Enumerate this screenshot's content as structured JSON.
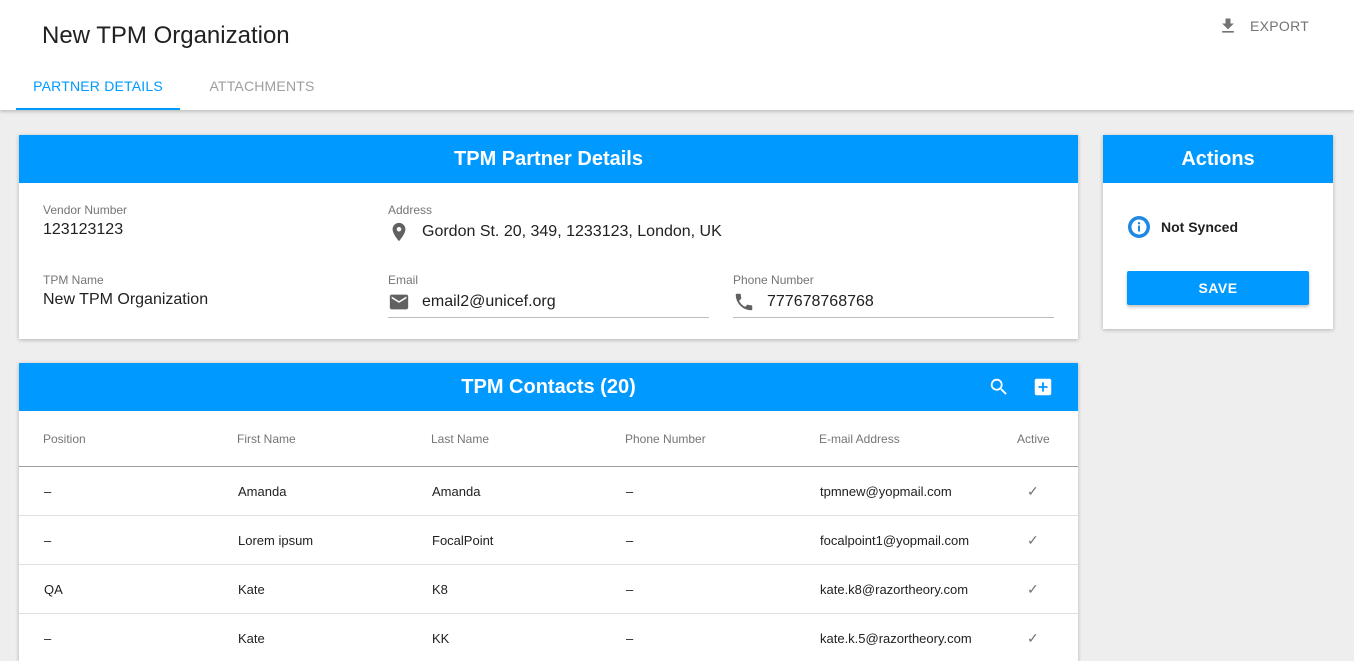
{
  "header": {
    "title": "New TPM Organization",
    "export_label": "EXPORT",
    "tabs": [
      {
        "label": "PARTNER DETAILS",
        "active": true
      },
      {
        "label": "ATTACHMENTS",
        "active": false
      }
    ]
  },
  "details": {
    "title": "TPM Partner Details",
    "vendor_number_label": "Vendor Number",
    "vendor_number": "123123123",
    "address_label": "Address",
    "address": "Gordon St. 20, 349, 1233123, London, UK",
    "tpm_name_label": "TPM Name",
    "tpm_name": "New TPM Organization",
    "email_label": "Email",
    "email": "email2@unicef.org",
    "phone_label": "Phone Number",
    "phone": "777678768768"
  },
  "actions": {
    "title": "Actions",
    "status": "Not Synced",
    "save_label": "SAVE"
  },
  "contacts": {
    "title": "TPM Contacts (20)",
    "columns": [
      "Position",
      "First Name",
      "Last Name",
      "Phone Number",
      "E-mail Address",
      "Active"
    ],
    "rows": [
      {
        "position": "–",
        "first_name": "Amanda",
        "last_name": "Amanda",
        "phone": "–",
        "email": "tpmnew@yopmail.com",
        "active": "✓"
      },
      {
        "position": "–",
        "first_name": "Lorem ipsum",
        "last_name": "FocalPoint",
        "phone": "–",
        "email": "focalpoint1@yopmail.com",
        "active": "✓"
      },
      {
        "position": "QA",
        "first_name": "Kate",
        "last_name": "K8",
        "phone": "–",
        "email": "kate.k8@razortheory.com",
        "active": "✓"
      },
      {
        "position": "–",
        "first_name": "Kate",
        "last_name": "KK",
        "phone": "–",
        "email": "kate.k.5@razortheory.com",
        "active": "✓"
      }
    ]
  },
  "colors": {
    "accent": "#0099ff",
    "background": "#eeeeee"
  }
}
